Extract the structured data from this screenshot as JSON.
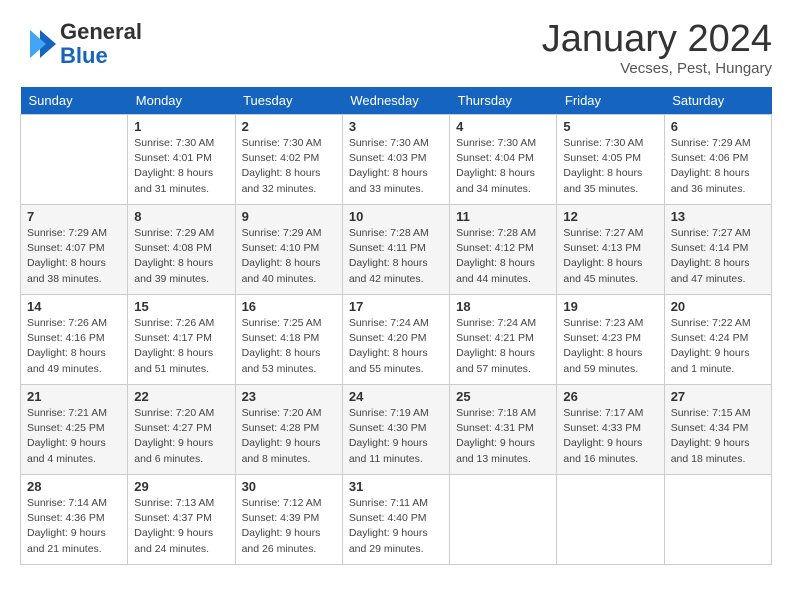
{
  "header": {
    "logo_general": "General",
    "logo_blue": "Blue",
    "title": "January 2024",
    "subtitle": "Vecses, Pest, Hungary"
  },
  "weekdays": [
    "Sunday",
    "Monday",
    "Tuesday",
    "Wednesday",
    "Thursday",
    "Friday",
    "Saturday"
  ],
  "weeks": [
    [
      {
        "day": "",
        "info": ""
      },
      {
        "day": "1",
        "info": "Sunrise: 7:30 AM\nSunset: 4:01 PM\nDaylight: 8 hours\nand 31 minutes."
      },
      {
        "day": "2",
        "info": "Sunrise: 7:30 AM\nSunset: 4:02 PM\nDaylight: 8 hours\nand 32 minutes."
      },
      {
        "day": "3",
        "info": "Sunrise: 7:30 AM\nSunset: 4:03 PM\nDaylight: 8 hours\nand 33 minutes."
      },
      {
        "day": "4",
        "info": "Sunrise: 7:30 AM\nSunset: 4:04 PM\nDaylight: 8 hours\nand 34 minutes."
      },
      {
        "day": "5",
        "info": "Sunrise: 7:30 AM\nSunset: 4:05 PM\nDaylight: 8 hours\nand 35 minutes."
      },
      {
        "day": "6",
        "info": "Sunrise: 7:29 AM\nSunset: 4:06 PM\nDaylight: 8 hours\nand 36 minutes."
      }
    ],
    [
      {
        "day": "7",
        "info": "Sunrise: 7:29 AM\nSunset: 4:07 PM\nDaylight: 8 hours\nand 38 minutes."
      },
      {
        "day": "8",
        "info": "Sunrise: 7:29 AM\nSunset: 4:08 PM\nDaylight: 8 hours\nand 39 minutes."
      },
      {
        "day": "9",
        "info": "Sunrise: 7:29 AM\nSunset: 4:10 PM\nDaylight: 8 hours\nand 40 minutes."
      },
      {
        "day": "10",
        "info": "Sunrise: 7:28 AM\nSunset: 4:11 PM\nDaylight: 8 hours\nand 42 minutes."
      },
      {
        "day": "11",
        "info": "Sunrise: 7:28 AM\nSunset: 4:12 PM\nDaylight: 8 hours\nand 44 minutes."
      },
      {
        "day": "12",
        "info": "Sunrise: 7:27 AM\nSunset: 4:13 PM\nDaylight: 8 hours\nand 45 minutes."
      },
      {
        "day": "13",
        "info": "Sunrise: 7:27 AM\nSunset: 4:14 PM\nDaylight: 8 hours\nand 47 minutes."
      }
    ],
    [
      {
        "day": "14",
        "info": "Sunrise: 7:26 AM\nSunset: 4:16 PM\nDaylight: 8 hours\nand 49 minutes."
      },
      {
        "day": "15",
        "info": "Sunrise: 7:26 AM\nSunset: 4:17 PM\nDaylight: 8 hours\nand 51 minutes."
      },
      {
        "day": "16",
        "info": "Sunrise: 7:25 AM\nSunset: 4:18 PM\nDaylight: 8 hours\nand 53 minutes."
      },
      {
        "day": "17",
        "info": "Sunrise: 7:24 AM\nSunset: 4:20 PM\nDaylight: 8 hours\nand 55 minutes."
      },
      {
        "day": "18",
        "info": "Sunrise: 7:24 AM\nSunset: 4:21 PM\nDaylight: 8 hours\nand 57 minutes."
      },
      {
        "day": "19",
        "info": "Sunrise: 7:23 AM\nSunset: 4:23 PM\nDaylight: 8 hours\nand 59 minutes."
      },
      {
        "day": "20",
        "info": "Sunrise: 7:22 AM\nSunset: 4:24 PM\nDaylight: 9 hours\nand 1 minute."
      }
    ],
    [
      {
        "day": "21",
        "info": "Sunrise: 7:21 AM\nSunset: 4:25 PM\nDaylight: 9 hours\nand 4 minutes."
      },
      {
        "day": "22",
        "info": "Sunrise: 7:20 AM\nSunset: 4:27 PM\nDaylight: 9 hours\nand 6 minutes."
      },
      {
        "day": "23",
        "info": "Sunrise: 7:20 AM\nSunset: 4:28 PM\nDaylight: 9 hours\nand 8 minutes."
      },
      {
        "day": "24",
        "info": "Sunrise: 7:19 AM\nSunset: 4:30 PM\nDaylight: 9 hours\nand 11 minutes."
      },
      {
        "day": "25",
        "info": "Sunrise: 7:18 AM\nSunset: 4:31 PM\nDaylight: 9 hours\nand 13 minutes."
      },
      {
        "day": "26",
        "info": "Sunrise: 7:17 AM\nSunset: 4:33 PM\nDaylight: 9 hours\nand 16 minutes."
      },
      {
        "day": "27",
        "info": "Sunrise: 7:15 AM\nSunset: 4:34 PM\nDaylight: 9 hours\nand 18 minutes."
      }
    ],
    [
      {
        "day": "28",
        "info": "Sunrise: 7:14 AM\nSunset: 4:36 PM\nDaylight: 9 hours\nand 21 minutes."
      },
      {
        "day": "29",
        "info": "Sunrise: 7:13 AM\nSunset: 4:37 PM\nDaylight: 9 hours\nand 24 minutes."
      },
      {
        "day": "30",
        "info": "Sunrise: 7:12 AM\nSunset: 4:39 PM\nDaylight: 9 hours\nand 26 minutes."
      },
      {
        "day": "31",
        "info": "Sunrise: 7:11 AM\nSunset: 4:40 PM\nDaylight: 9 hours\nand 29 minutes."
      },
      {
        "day": "",
        "info": ""
      },
      {
        "day": "",
        "info": ""
      },
      {
        "day": "",
        "info": ""
      }
    ]
  ]
}
